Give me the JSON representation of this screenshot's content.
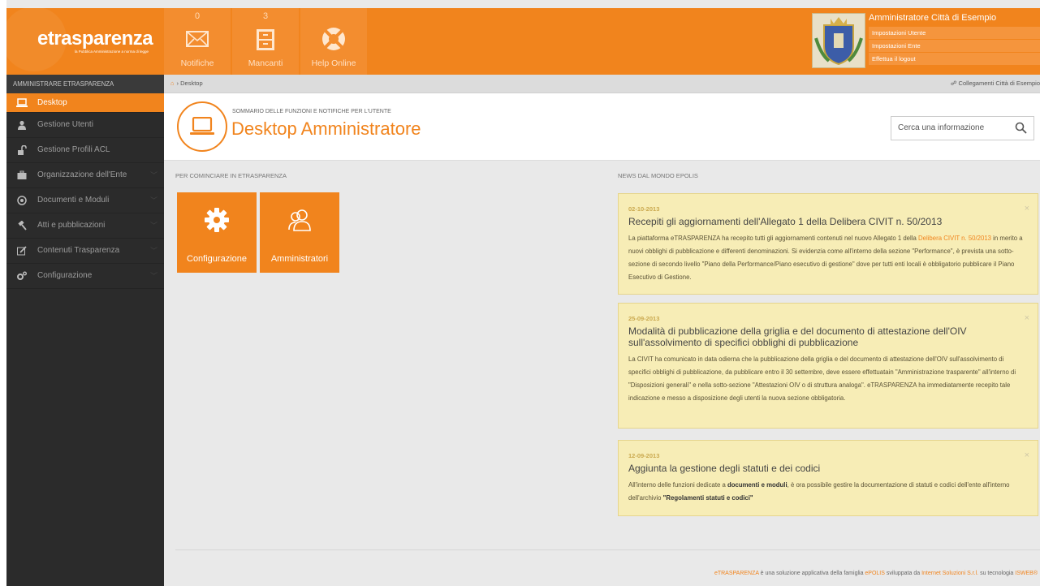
{
  "header": {
    "logo_text": "etrasparenza",
    "logo_tagline": "la Pubblica Amministrazione a norma di legge",
    "buttons": [
      {
        "count": "0",
        "label": "Notifiche",
        "icon": "envelope-icon"
      },
      {
        "count": "3",
        "label": "Mancanti",
        "icon": "cabinet-icon"
      },
      {
        "count": "",
        "label": "Help Online",
        "icon": "lifebuoy-icon"
      }
    ],
    "admin": {
      "title": "Amministratore Città di Esempio",
      "links": [
        "Impostazioni Utente",
        "Impostazioni Ente",
        "Effettua il logout"
      ]
    }
  },
  "sidebar": {
    "heading": "AMMINISTRARE ETRASPARENZA",
    "items": [
      {
        "label": "Desktop",
        "icon": "laptop-icon",
        "active": true
      },
      {
        "label": "Gestione Utenti",
        "icon": "user-icon"
      },
      {
        "label": "Gestione Profili ACL",
        "icon": "lock-icon"
      },
      {
        "label": "Organizzazione dell'Ente",
        "icon": "briefcase-icon"
      },
      {
        "label": "Documenti e Moduli",
        "icon": "circle-icon"
      },
      {
        "label": "Atti e pubblicazioni",
        "icon": "gavel-icon"
      },
      {
        "label": "Contenuti Trasparenza",
        "icon": "edit-icon"
      },
      {
        "label": "Configurazione",
        "icon": "cogs-icon"
      }
    ]
  },
  "breadcrumb": {
    "current": "Desktop",
    "links_label": "Collegamenti Città di Esempio"
  },
  "page": {
    "subtitle": "SOMMARIO DELLE FUNZIONI E NOTIFICHE PER L'UTENTE",
    "title": "Desktop Amministratore",
    "search_placeholder": "Cerca una informazione"
  },
  "start": {
    "heading": "PER COMINCIARE IN ETRASPARENZA",
    "tiles": [
      {
        "label": "Configurazione",
        "icon": "gear-icon"
      },
      {
        "label": "Amministratori",
        "icon": "users-icon"
      }
    ]
  },
  "news": {
    "heading": "NEWS DAL MONDO EPOLIS",
    "items": [
      {
        "date": "02-10-2013",
        "title": "Recepiti gli aggiornamenti dell'Allegato 1 della Delibera CIVIT n. 50/2013",
        "body_1": "La piattaforma eTRASPARENZA ha recepito tutti gli aggiornamenti contenuti nel nuovo Allegato 1 della ",
        "body_link": "Delibera CIVIT n. 50/2013",
        "body_2": " in merito a nuovi obblighi di pubblicazione e differenti denominazioni. Si evidenzia come all'interno della sezione \"Performance\", è prevista una sotto-sezione di secondo livello \"Piano della Performance/Piano esecutivo di gestione\" dove per tutti enti locali è obbligatorio pubblicare il Piano Esecutivo di Gestione."
      },
      {
        "date": "25-09-2013",
        "title": "Modalità di pubblicazione della griglia e del documento di attestazione dell'OIV sull'assolvimento di specifici obblighi di pubblicazione",
        "body": "La CIVIT ha comunicato in data odierna che la pubblicazione della griglia e del documento di attestazione dell'OIV sull'assolvimento di specifici obblighi di pubblicazione, da pubblicare entro il 30 settembre, deve essere effettuatain \"Amministrazione trasparente\" all'interno di \"Disposizioni generali\" e nella sotto-sezione \"Attestazioni OIV o di struttura analoga\". eTRASPARENZA ha immediatamente recepito tale indicazione e messo a disposizione degli utenti la nuova sezione obbligatoria."
      },
      {
        "date": "12-09-2013",
        "title": "Aggiunta la gestione degli statuti e dei codici",
        "body_1": "All'interno delle funzioni dedicate a ",
        "body_bold_1": "documenti e moduli",
        "body_2": ", è ora possibile gestire la documentazione di statuti e codici dell'ente all'interno dell'archivio ",
        "body_bold_2": "\"Regolamenti statuti e codici\""
      }
    ],
    "close_symbol": "×"
  },
  "footer": {
    "part1": "eTRASPARENZA",
    "part2": " è una soluzione applicativa della famiglia ",
    "part3": "ePOLIS",
    "part4": " sviluppata da ",
    "part5": "Internet Soluzioni S.r.l.",
    "part6": " su tecnologia ",
    "part7": "ISWEB®"
  },
  "colors": {
    "accent": "#f1841d",
    "sidebar": "#2b2b2b",
    "news_bg": "#f7edb6"
  }
}
